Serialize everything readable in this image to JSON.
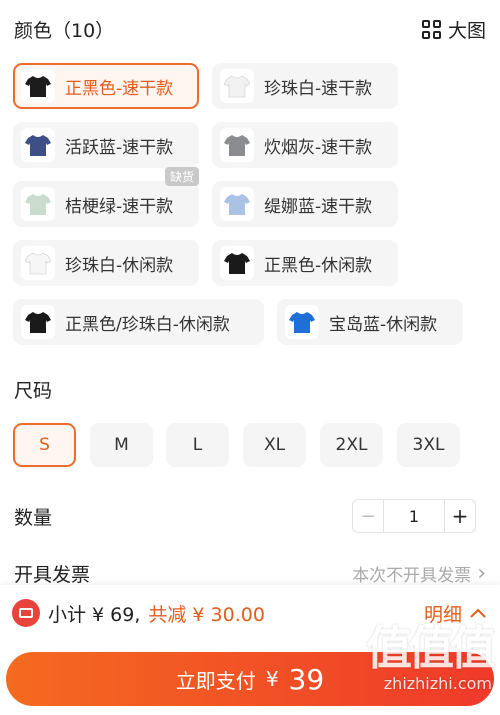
{
  "colors": {
    "accent": "#ec6b2d",
    "accent_text": "#e35d1c",
    "chip_bg": "#f5f5f5",
    "pay_gradient_start": "#f46a20",
    "pay_gradient_end": "#ef3a2a"
  },
  "color_section": {
    "title": "颜色（10）",
    "big_view_label": "大图",
    "options": [
      {
        "label": "正黑色-速干款",
        "shirt": "#1c1c1c",
        "selected": true
      },
      {
        "label": "珍珠白-速干款",
        "shirt": "#f2f2f2",
        "selected": false
      },
      {
        "label": "活跃蓝-速干款",
        "shirt": "#3e4f86",
        "selected": false
      },
      {
        "label": "炊烟灰-速干款",
        "shirt": "#8a8c8f",
        "selected": false
      },
      {
        "label": "桔梗绿-速干款",
        "shirt": "#c9dccd",
        "selected": false,
        "badge": "缺货"
      },
      {
        "label": "缇娜蓝-速干款",
        "shirt": "#a9c2e6",
        "selected": false
      },
      {
        "label": "珍珠白-休闲款",
        "shirt": "#f6f6f6",
        "selected": false
      },
      {
        "label": "正黑色-休闲款",
        "shirt": "#1a1a1a",
        "selected": false
      },
      {
        "label": "正黑色/珍珠白-休闲款",
        "shirt": "#1a1a1a",
        "selected": false
      },
      {
        "label": "宝岛蓝-休闲款",
        "shirt": "#1f6fd6",
        "selected": false
      }
    ]
  },
  "size_section": {
    "title": "尺码",
    "options": [
      {
        "label": "S",
        "selected": true
      },
      {
        "label": "M",
        "selected": false
      },
      {
        "label": "L",
        "selected": false
      },
      {
        "label": "XL",
        "selected": false
      },
      {
        "label": "2XL",
        "selected": false
      },
      {
        "label": "3XL",
        "selected": false
      }
    ]
  },
  "quantity_section": {
    "title": "数量",
    "minus": "−",
    "value": "1",
    "plus": "+"
  },
  "invoice": {
    "title": "开具发票",
    "value": "本次不开具发票",
    "chevron": "›"
  },
  "summary": {
    "subtotal": "小计 ¥ 69,",
    "discount": "共减 ¥ 30.00",
    "details_label": "明细",
    "details_icon": "chevron-up-icon"
  },
  "pay": {
    "label": "立即支付",
    "currency": "¥",
    "amount": "39"
  },
  "watermark": {
    "logo": "值值值",
    "site": "zhizhizhi.com"
  }
}
